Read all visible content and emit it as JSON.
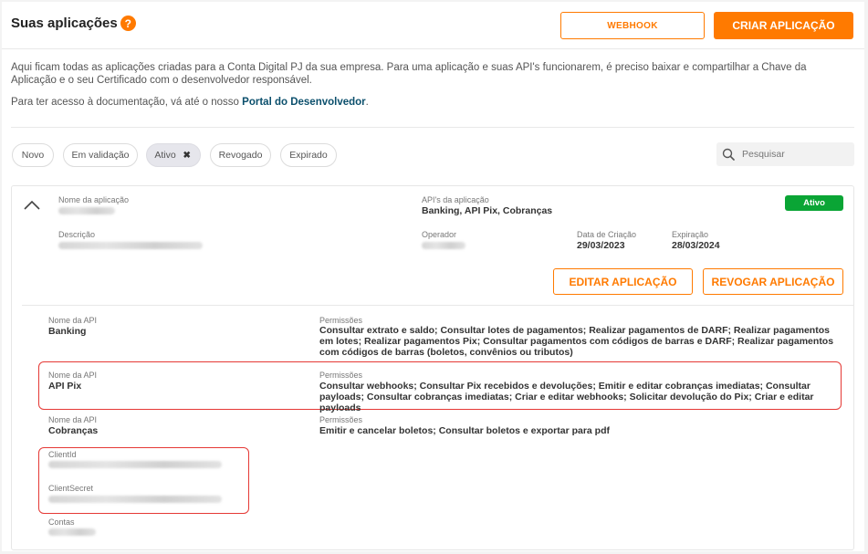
{
  "header": {
    "title": "Suas aplicações",
    "help_glyph": "?",
    "webhook_label": "WEBHOOK",
    "create_label": "CRIAR APLICAÇÃO"
  },
  "intro": {
    "text": "Aqui ficam todas as aplicações criadas para a Conta Digital PJ da sua empresa. Para uma aplicação e suas API's funcionarem, é preciso baixar e compartilhar a Chave da Aplicação e o seu Certificado com o desenvolvedor responsável.",
    "doc_prefix": "Para ter acesso à documentação, vá até o nosso",
    "doc_link": "Portal do Desenvolvedor",
    "doc_suffix": "."
  },
  "filters": {
    "chips": [
      {
        "label": "Novo",
        "active": false
      },
      {
        "label": "Em validação",
        "active": false
      },
      {
        "label": "Ativo",
        "active": true
      },
      {
        "label": "Revogado",
        "active": false
      },
      {
        "label": "Expirado",
        "active": false
      }
    ],
    "remove_glyph": "✖",
    "search_placeholder": "Pesquisar"
  },
  "app": {
    "name_label": "Nome da aplicação",
    "apis_label": "API's da aplicação",
    "apis_value": "Banking, API Pix, Cobranças",
    "status": "Ativo",
    "description_label": "Descrição",
    "operator_label": "Operador",
    "created_label": "Data de Criação",
    "created_value": "29/03/2023",
    "expiry_label": "Expiração",
    "expiry_value": "28/03/2024",
    "edit_label": "EDITAR APLICAÇÃO",
    "revoke_label": "REVOGAR APLICAÇÃO",
    "api_label": "Nome da API",
    "permissions_label": "Permissões",
    "apis": [
      {
        "name": "Banking",
        "permissions": "Consultar extrato e saldo; Consultar lotes de pagamentos; Realizar pagamentos de DARF; Realizar pagamentos em lotes; Realizar pagamentos Pix; Consultar pagamentos com códigos de barras e DARF; Realizar pagamentos com códigos de barras (boletos, convênios ou tributos)"
      },
      {
        "name": "API Pix",
        "permissions": "Consultar webhooks; Consultar Pix recebidos e devoluções; Emitir e editar cobranças imediatas; Consultar payloads; Consultar cobranças imediatas; Criar e editar webhooks; Solicitar devolução do Pix; Criar e editar payloads"
      },
      {
        "name": "Cobranças",
        "permissions": "Emitir e cancelar boletos; Consultar boletos e exportar para pdf"
      }
    ],
    "client_id_label": "ClientId",
    "client_secret_label": "ClientSecret",
    "accounts_label": "Contas"
  },
  "colors": {
    "accent": "#ff7a00",
    "status_active": "#0aa535",
    "highlight": "#e53935",
    "link": "#0b4f6c"
  }
}
